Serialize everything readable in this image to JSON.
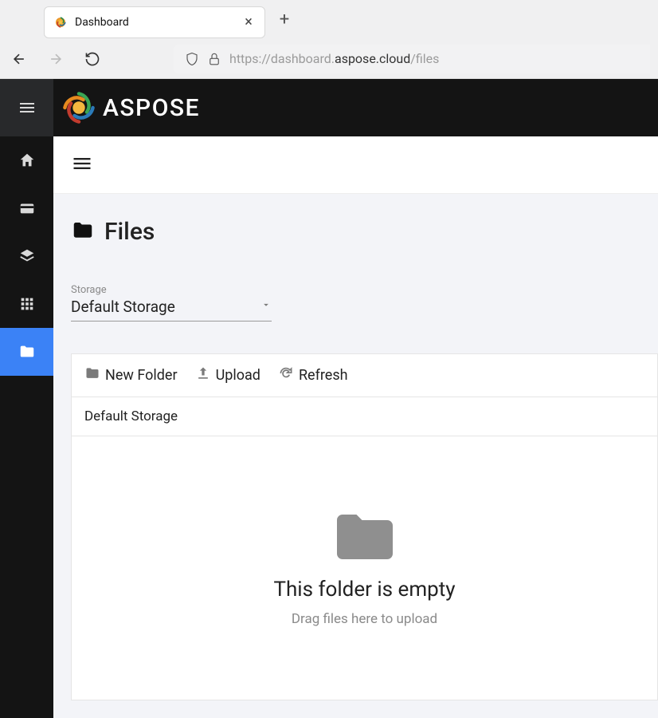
{
  "browser": {
    "tab_title": "Dashboard",
    "url_prefix": "https://dashboard.",
    "url_emph": "aspose.cloud",
    "url_suffix": "/files"
  },
  "brand": {
    "name": "ASPOSE"
  },
  "sidebar": {
    "items": [
      {
        "name": "home"
      },
      {
        "name": "billing"
      },
      {
        "name": "layers"
      },
      {
        "name": "apps"
      },
      {
        "name": "files"
      }
    ]
  },
  "page": {
    "title": "Files",
    "storage_label": "Storage",
    "storage_value": "Default Storage",
    "actions": {
      "new_folder": "New Folder",
      "upload": "Upload",
      "refresh": "Refresh"
    },
    "breadcrumb": "Default Storage",
    "empty_title": "This folder is empty",
    "empty_sub": "Drag files here to upload"
  }
}
